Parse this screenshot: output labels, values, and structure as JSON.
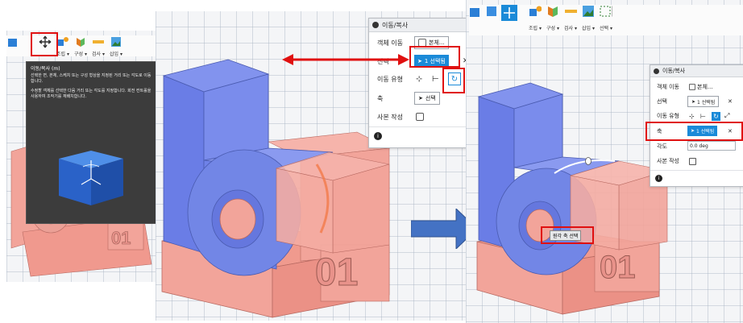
{
  "left": {
    "toolbar_labels": [
      "조립 ▾",
      "구성 ▾",
      "검사 ▾",
      "삽입 ▾"
    ],
    "tooltip": {
      "title": "이동/복사 (m)",
      "line1": "선택한 면, 본체, 스케치 또는 구성 형상을 지정된 거리 또는 각도로 이동합니다.",
      "line2": "수정할 객체를 선택한 다음 거리 또는 각도를 지정합니다. 회전 컨트롤을 사용하여 조작기를 재배치합니다."
    },
    "engraving": "01"
  },
  "middle": {
    "panel": {
      "title": "이동/복사",
      "row_object": "객체 이동",
      "object_value": "본체...",
      "row_select": "선택",
      "select_value": "1 선택됨",
      "row_type": "이동 유형",
      "row_axis": "축",
      "axis_value": "선택",
      "row_copy": "사본 작성",
      "close_glyph": "✕",
      "info_glyph": "i"
    },
    "engraving": "01"
  },
  "right": {
    "toolbar_labels": [
      "조립 ▾",
      "구성 ▾",
      "검사 ▾",
      "삽입 ▾",
      "선택 ▾"
    ],
    "panel": {
      "title": "이동/복사",
      "row_object": "객체 이동",
      "object_value": "본체...",
      "row_select": "선택",
      "select_value": "1 선택됨",
      "row_type": "이동 유형",
      "row_axis": "축",
      "axis_value": "1 선택됨",
      "row_angle": "각도",
      "angle_value": "0.0 deg",
      "row_copy": "사본 작성",
      "close_glyph": "✕",
      "info_glyph": "i"
    },
    "viewport_hint": "원각 축 선택",
    "engraving": "01"
  },
  "colors": {
    "blue_part": "#6f82e8",
    "pink_part": "#f2a49a",
    "select_blue": "#1a8ad8",
    "annotation_red": "#e01010"
  }
}
